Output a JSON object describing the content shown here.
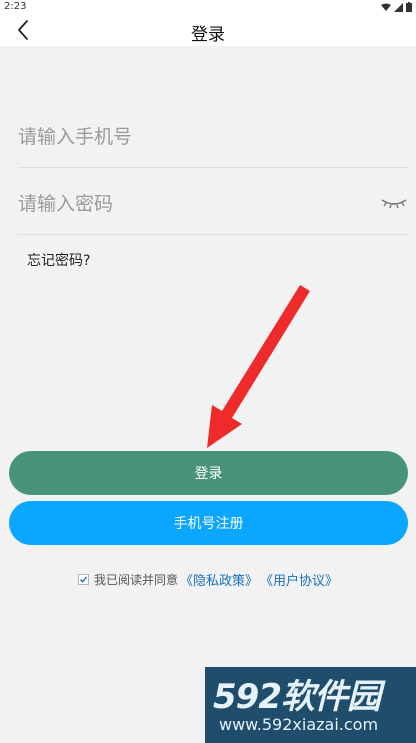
{
  "status_bar": {
    "time": "2:23"
  },
  "nav": {
    "title": "登录"
  },
  "form": {
    "phone_placeholder": "请输入手机号",
    "password_placeholder": "请输入密码",
    "forgot_label": "忘记密码?"
  },
  "buttons": {
    "login_label": "登录",
    "register_label": "手机号注册"
  },
  "agreement": {
    "checked": true,
    "text": "我已阅读并同意",
    "privacy_link": "《隐私政策》",
    "user_link": "《用户协议》"
  },
  "watermark": {
    "logo_text": "592软件园",
    "url": "www.592xiazai.com"
  },
  "colors": {
    "login_button": "#47947b",
    "register_button": "#0aa6ff",
    "link": "#1a6fbf",
    "arrow": "#ef2a2a"
  }
}
